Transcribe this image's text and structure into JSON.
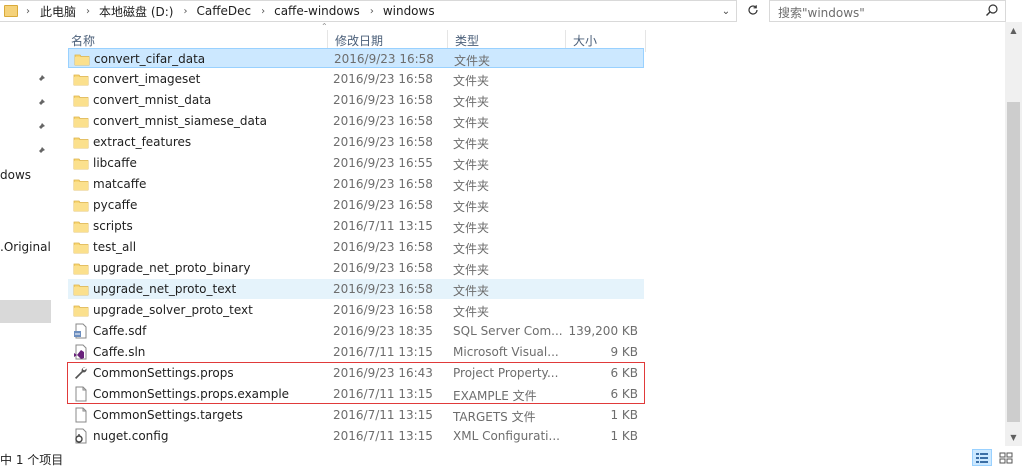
{
  "address": {
    "crumbs": [
      "此电脑",
      "本地磁盘 (D:)",
      "CaffeDec",
      "caffe-windows",
      "windows"
    ],
    "search_placeholder": "搜索\"windows\""
  },
  "nav": {
    "partial_labels": [
      "dows",
      ".Original."
    ]
  },
  "columns": {
    "name": "名称",
    "date": "修改日期",
    "type": "类型",
    "size": "大小"
  },
  "files": [
    {
      "name": "convert_cifar_data",
      "date": "2016/9/23 16:58",
      "type": "文件夹",
      "size": "",
      "icon": "folder-icon",
      "state": "selected"
    },
    {
      "name": "convert_imageset",
      "date": "2016/9/23 16:58",
      "type": "文件夹",
      "size": "",
      "icon": "folder-icon",
      "state": ""
    },
    {
      "name": "convert_mnist_data",
      "date": "2016/9/23 16:58",
      "type": "文件夹",
      "size": "",
      "icon": "folder-icon",
      "state": ""
    },
    {
      "name": "convert_mnist_siamese_data",
      "date": "2016/9/23 16:58",
      "type": "文件夹",
      "size": "",
      "icon": "folder-icon",
      "state": ""
    },
    {
      "name": "extract_features",
      "date": "2016/9/23 16:58",
      "type": "文件夹",
      "size": "",
      "icon": "folder-icon",
      "state": ""
    },
    {
      "name": "libcaffe",
      "date": "2016/9/23 16:55",
      "type": "文件夹",
      "size": "",
      "icon": "folder-icon",
      "state": ""
    },
    {
      "name": "matcaffe",
      "date": "2016/9/23 16:58",
      "type": "文件夹",
      "size": "",
      "icon": "folder-icon",
      "state": ""
    },
    {
      "name": "pycaffe",
      "date": "2016/9/23 16:58",
      "type": "文件夹",
      "size": "",
      "icon": "folder-icon",
      "state": ""
    },
    {
      "name": "scripts",
      "date": "2016/7/11 13:15",
      "type": "文件夹",
      "size": "",
      "icon": "folder-icon",
      "state": ""
    },
    {
      "name": "test_all",
      "date": "2016/9/23 16:58",
      "type": "文件夹",
      "size": "",
      "icon": "folder-icon",
      "state": ""
    },
    {
      "name": "upgrade_net_proto_binary",
      "date": "2016/9/23 16:58",
      "type": "文件夹",
      "size": "",
      "icon": "folder-icon",
      "state": ""
    },
    {
      "name": "upgrade_net_proto_text",
      "date": "2016/9/23 16:58",
      "type": "文件夹",
      "size": "",
      "icon": "folder-icon",
      "state": "hover"
    },
    {
      "name": "upgrade_solver_proto_text",
      "date": "2016/9/23 16:58",
      "type": "文件夹",
      "size": "",
      "icon": "folder-icon",
      "state": ""
    },
    {
      "name": "Caffe.sdf",
      "date": "2016/9/23 18:35",
      "type": "SQL Server Com...",
      "size": "139,200 KB",
      "icon": "sdf-file-icon",
      "state": ""
    },
    {
      "name": "Caffe.sln",
      "date": "2016/7/11 13:15",
      "type": "Microsoft Visual...",
      "size": "9 KB",
      "icon": "visual-studio-solution-icon",
      "state": ""
    },
    {
      "name": "CommonSettings.props",
      "date": "2016/9/23 16:43",
      "type": "Project Property...",
      "size": "6 KB",
      "icon": "wrench-icon",
      "state": ""
    },
    {
      "name": "CommonSettings.props.example",
      "date": "2016/7/11 13:15",
      "type": "EXAMPLE 文件",
      "size": "6 KB",
      "icon": "blank-file-icon",
      "state": ""
    },
    {
      "name": "CommonSettings.targets",
      "date": "2016/7/11 13:15",
      "type": "TARGETS 文件",
      "size": "1 KB",
      "icon": "blank-file-icon",
      "state": ""
    },
    {
      "name": "nuget.config",
      "date": "2016/7/11 13:15",
      "type": "XML Configurati...",
      "size": "1 KB",
      "icon": "config-file-icon",
      "state": ""
    }
  ],
  "status": {
    "text": "中 1 个项目"
  },
  "colors": {
    "selected_bg": "#cce8ff",
    "selected_border": "#99d1ff",
    "hover_bg": "#e5f3fb",
    "folder": "#f5d27a",
    "annotation_red": "#e03a3a",
    "header_text": "#4c607a"
  }
}
